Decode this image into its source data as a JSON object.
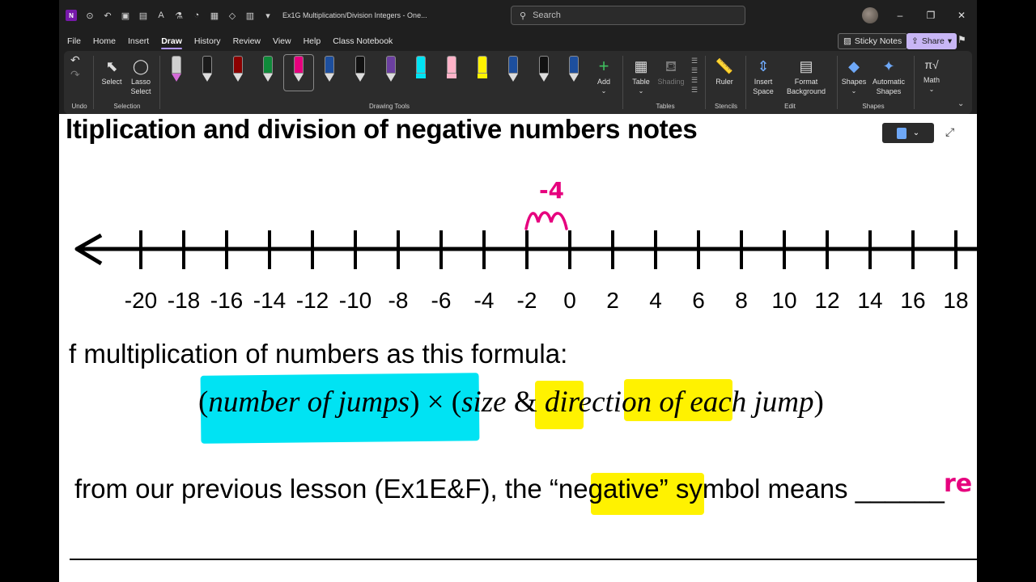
{
  "window": {
    "title": "Ex1G Multiplication/Division Integers  -  One...",
    "search_placeholder": "Search",
    "app_icon_label": "N",
    "controls": [
      "–",
      "❐",
      "✕"
    ]
  },
  "menu": {
    "items": [
      "File",
      "Home",
      "Insert",
      "Draw",
      "History",
      "Review",
      "View",
      "Help",
      "Class Notebook"
    ],
    "active": "Draw",
    "sticky_notes": "Sticky Notes",
    "share": "Share"
  },
  "ribbon": {
    "groups": {
      "undo": "Undo",
      "selection": "Selection",
      "drawing_tools": "Drawing Tools",
      "tables": "Tables",
      "stencils": "Stencils",
      "edit": "Edit",
      "shapes": "Shapes"
    },
    "buttons": {
      "select": "Select",
      "lasso_line1": "Lasso",
      "lasso_line2": "Select",
      "add": "Add",
      "table": "Table",
      "shading": "Shading",
      "ruler": "Ruler",
      "insert_space_line1": "Insert",
      "insert_space_line2": "Space",
      "format_bg_line1": "Format",
      "format_bg_line2": "Background",
      "shapes": "Shapes",
      "automatic_shapes_line1": "Automatic",
      "automatic_shapes_line2": "Shapes",
      "math": "Math"
    },
    "pens": [
      {
        "color": "#c9c9c9",
        "kind": "eraser",
        "accent": "#d36bd6"
      },
      {
        "color": "#1a1a1a",
        "kind": "pen",
        "accent": "#ffffff"
      },
      {
        "color": "#8b0000",
        "kind": "pen",
        "accent": "#b00000"
      },
      {
        "color": "#0f8a3a",
        "kind": "pen",
        "accent": "#0f8a3a"
      },
      {
        "color": "#e6007e",
        "kind": "pen",
        "accent": "#e6007e"
      },
      {
        "color": "#1d4f9e",
        "kind": "pen",
        "accent": "#1d4f9e"
      },
      {
        "color": "#111111",
        "kind": "pen",
        "accent": "#111111"
      },
      {
        "color": "#6b3fa0",
        "kind": "pen",
        "accent": "#6b3fa0"
      },
      {
        "color": "#00e3f3",
        "kind": "highlighter",
        "accent": "#00e3f3"
      },
      {
        "color": "#ffb3c8",
        "kind": "highlighter",
        "accent": "#ffb3c8"
      },
      {
        "color": "#fff200",
        "kind": "highlighter",
        "accent": "#fff200"
      },
      {
        "color": "#1d4f9e",
        "kind": "pencil",
        "accent": "#1d4f9e"
      },
      {
        "color": "#111111",
        "kind": "pencil",
        "accent": "#111111"
      },
      {
        "color": "#1d4f9e",
        "kind": "pencil",
        "accent": "#1d4f9e"
      }
    ]
  },
  "page": {
    "title": "ltiplication and division of negative numbers notes",
    "number_line": {
      "labels": [
        "-20",
        "-18",
        "-16",
        "-14",
        "-12",
        "-10",
        "-8",
        "-6",
        "-4",
        "-2",
        "0",
        "2",
        "4",
        "6",
        "8",
        "10",
        "12",
        "14",
        "16",
        "18"
      ],
      "annotation": "-4"
    },
    "line1": "f multiplication of numbers as this formula:",
    "formula": {
      "open1": "(",
      "part1": "number of  jumps",
      "close1": ")",
      "times": " × (",
      "part2": "size",
      "amp": " & ",
      "part3": "direction",
      "part4": " of  each jump",
      "close2": ")"
    },
    "line2_prefix": "from our previous lesson (Ex1E&F), the “",
    "line2_highlight": "negative",
    "line2_suffix": "” symbol means ______",
    "handwriting_end": "re"
  },
  "colors": {
    "ink_pink": "#e6007e",
    "cyan_highlight": "#00e3f3",
    "yellow_highlight": "#fff200",
    "accent": "#c8b6f5"
  }
}
